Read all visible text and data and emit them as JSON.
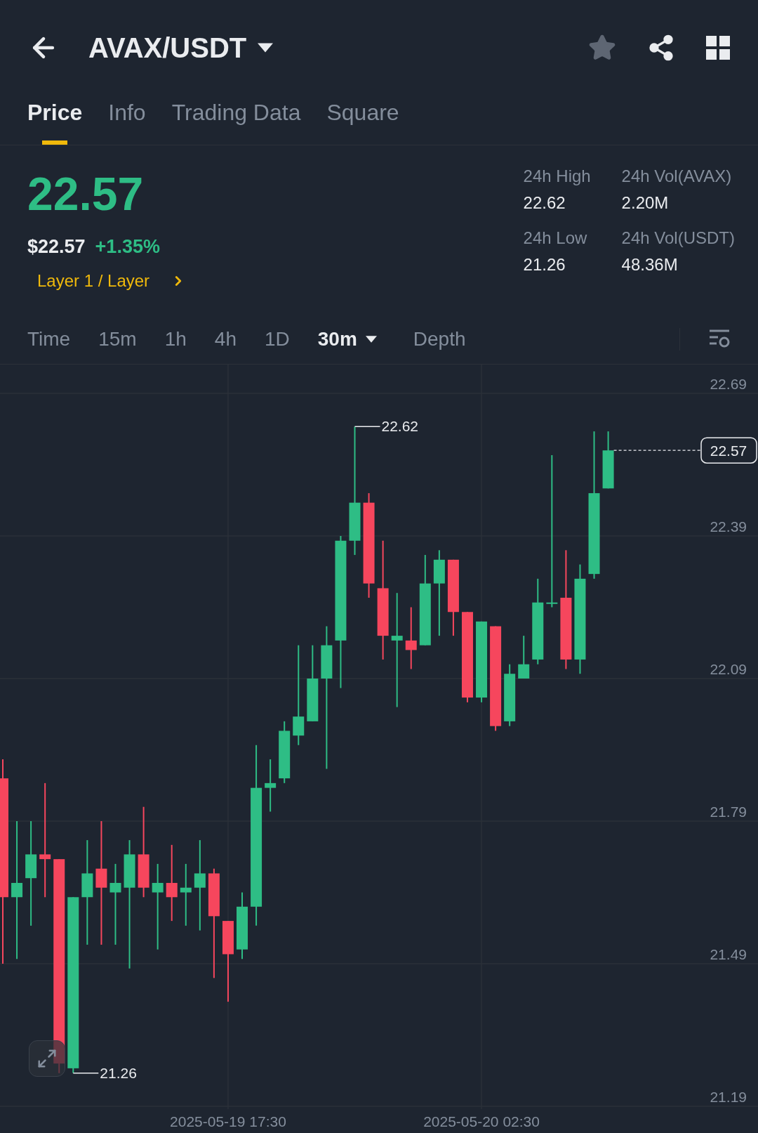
{
  "header": {
    "pair": "AVAX/USDT",
    "favorite": false
  },
  "tabs": [
    {
      "label": "Price",
      "selected": true
    },
    {
      "label": "Info",
      "selected": false
    },
    {
      "label": "Trading Data",
      "selected": false
    },
    {
      "label": "Square",
      "selected": false
    }
  ],
  "ticker": {
    "price": "22.57",
    "fiat_price": "$22.57",
    "change": "+1.35%",
    "category": "Layer 1 / Layer"
  },
  "stats": [
    {
      "label": "24h High",
      "value": "22.62"
    },
    {
      "label": "24h Vol(AVAX)",
      "value": "2.20M"
    },
    {
      "label": "24h Low",
      "value": "21.26"
    },
    {
      "label": "24h Vol(USDT)",
      "value": "48.36M"
    }
  ],
  "intervals": [
    {
      "label": "Time",
      "selected": false,
      "kind": "plain"
    },
    {
      "label": "15m",
      "selected": false,
      "kind": "plain"
    },
    {
      "label": "1h",
      "selected": false,
      "kind": "plain"
    },
    {
      "label": "4h",
      "selected": false,
      "kind": "plain"
    },
    {
      "label": "1D",
      "selected": false,
      "kind": "plain"
    },
    {
      "label": "30m",
      "selected": true,
      "kind": "dropdown"
    },
    {
      "label": "Depth",
      "selected": false,
      "kind": "plain"
    }
  ],
  "chart": {
    "y_labels": [
      "22.69",
      "22.39",
      "22.09",
      "21.79",
      "21.49",
      "21.19"
    ],
    "x_labels": [
      "2025-05-19 17:30",
      "2025-05-20 02:30"
    ],
    "high_marker": "22.62",
    "low_marker": "21.26",
    "last_price": "22.57"
  }
}
